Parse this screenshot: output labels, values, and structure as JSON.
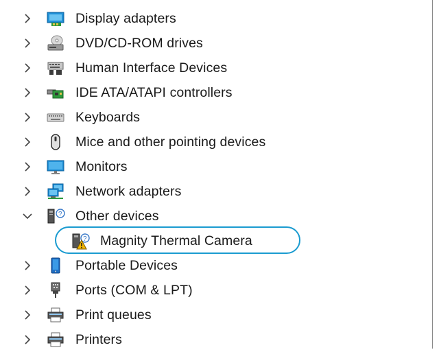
{
  "device_manager": {
    "categories": [
      {
        "label": "Display adapters",
        "expanded": false,
        "icon": "display-adapter-icon"
      },
      {
        "label": "DVD/CD-ROM drives",
        "expanded": false,
        "icon": "dvd-drive-icon"
      },
      {
        "label": "Human Interface Devices",
        "expanded": false,
        "icon": "hid-icon"
      },
      {
        "label": "IDE ATA/ATAPI controllers",
        "expanded": false,
        "icon": "ide-controller-icon"
      },
      {
        "label": "Keyboards",
        "expanded": false,
        "icon": "keyboard-icon"
      },
      {
        "label": "Mice and other pointing devices",
        "expanded": false,
        "icon": "mouse-icon"
      },
      {
        "label": "Monitors",
        "expanded": false,
        "icon": "monitor-icon"
      },
      {
        "label": "Network adapters",
        "expanded": false,
        "icon": "network-adapter-icon"
      },
      {
        "label": "Other devices",
        "expanded": true,
        "icon": "other-devices-icon"
      },
      {
        "label": "Magnity Thermal Camera",
        "child": true,
        "icon": "unknown-device-warning-icon",
        "highlighted": true
      },
      {
        "label": "Portable Devices",
        "expanded": false,
        "icon": "portable-device-icon"
      },
      {
        "label": "Ports (COM & LPT)",
        "expanded": false,
        "icon": "port-icon"
      },
      {
        "label": "Print queues",
        "expanded": false,
        "icon": "printer-icon"
      },
      {
        "label": "Printers",
        "expanded": false,
        "icon": "printer-icon"
      }
    ],
    "colors": {
      "highlight_ring": "#1a9bd0",
      "warning": "#f2b600",
      "text": "#1a1a1a"
    }
  }
}
